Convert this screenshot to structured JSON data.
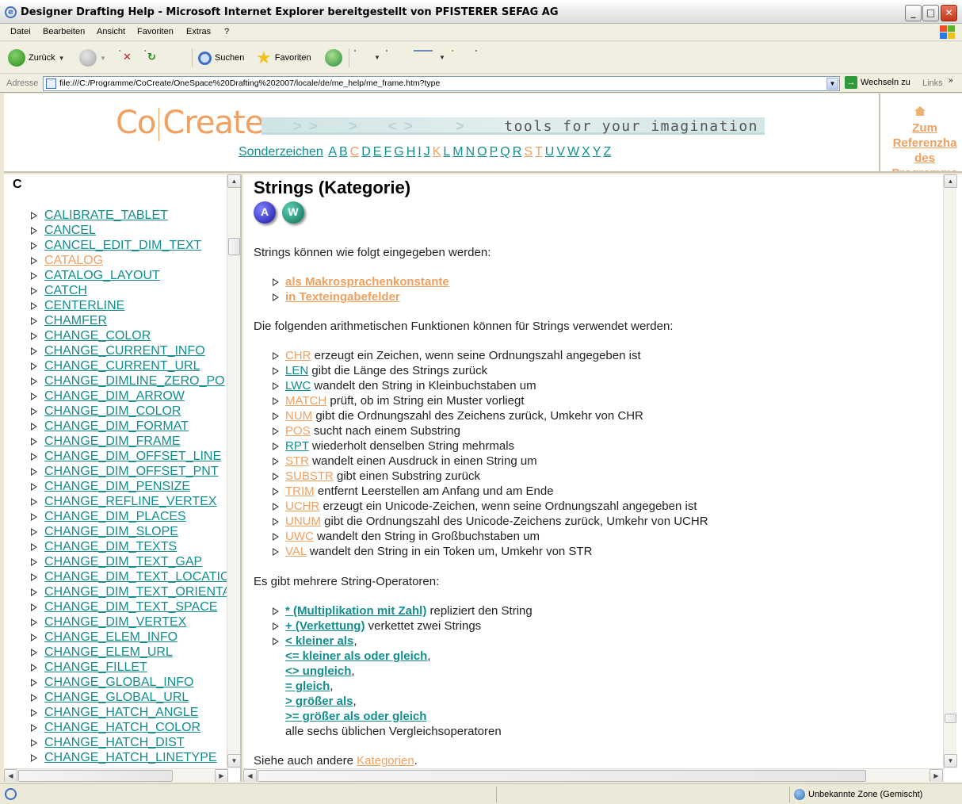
{
  "window": {
    "title": "Designer Drafting Help - Microsoft Internet Explorer bereitgestellt von PFISTERER SEFAG AG"
  },
  "menu": [
    "Datei",
    "Bearbeiten",
    "Ansicht",
    "Favoriten",
    "Extras",
    "?"
  ],
  "toolbar": {
    "back_label": "Zurück",
    "search_label": "Suchen",
    "favorites_label": "Favoriten"
  },
  "address": {
    "label": "Adresse",
    "url": "file:///C:/Programme/CoCreate/OneSpace%20Drafting%202007/locale/de/me_help/me_frame.htm?type",
    "go_label": "Wechseln zu",
    "links_label": "Links"
  },
  "header": {
    "logo_left": "Co",
    "logo_right": "Create",
    "tagline": "tools for your imagination",
    "special_chars": "Sonderzeichen",
    "letters": [
      {
        "l": "A",
        "c": "teal"
      },
      {
        "l": "B",
        "c": "teal"
      },
      {
        "l": "C",
        "c": "orange"
      },
      {
        "l": "D",
        "c": "teal"
      },
      {
        "l": "E",
        "c": "teal"
      },
      {
        "l": "F",
        "c": "teal"
      },
      {
        "l": "G",
        "c": "teal"
      },
      {
        "l": "H",
        "c": "teal"
      },
      {
        "l": "I",
        "c": "teal"
      },
      {
        "l": "J",
        "c": "teal"
      },
      {
        "l": "K",
        "c": "orange"
      },
      {
        "l": "L",
        "c": "teal"
      },
      {
        "l": "M",
        "c": "teal"
      },
      {
        "l": "N",
        "c": "teal"
      },
      {
        "l": "O",
        "c": "teal"
      },
      {
        "l": "P",
        "c": "teal"
      },
      {
        "l": "Q",
        "c": "teal"
      },
      {
        "l": "R",
        "c": "teal"
      },
      {
        "l": "S",
        "c": "orange"
      },
      {
        "l": "T",
        "c": "orange"
      },
      {
        "l": "U",
        "c": "teal"
      },
      {
        "l": "V",
        "c": "teal"
      },
      {
        "l": "W",
        "c": "teal"
      },
      {
        "l": "X",
        "c": "teal"
      },
      {
        "l": "Y",
        "c": "teal"
      },
      {
        "l": "Z",
        "c": "teal"
      }
    ],
    "ref_link_lines": [
      "Zum",
      "Referenzha",
      "des",
      "Programms"
    ]
  },
  "left": {
    "letter": "C",
    "items": [
      {
        "t": "CALIBRATE_TABLET",
        "c": "teal"
      },
      {
        "t": "CANCEL",
        "c": "teal"
      },
      {
        "t": "CANCEL_EDIT_DIM_TEXT",
        "c": "teal"
      },
      {
        "t": "CATALOG",
        "c": "orange"
      },
      {
        "t": "CATALOG_LAYOUT",
        "c": "teal"
      },
      {
        "t": "CATCH",
        "c": "teal"
      },
      {
        "t": "CENTERLINE",
        "c": "teal"
      },
      {
        "t": "CHAMFER",
        "c": "teal"
      },
      {
        "t": "CHANGE_COLOR",
        "c": "teal"
      },
      {
        "t": "CHANGE_CURRENT_INFO",
        "c": "teal"
      },
      {
        "t": "CHANGE_CURRENT_URL",
        "c": "teal"
      },
      {
        "t": "CHANGE_DIMLINE_ZERO_PO",
        "c": "teal"
      },
      {
        "t": "CHANGE_DIM_ARROW",
        "c": "teal"
      },
      {
        "t": "CHANGE_DIM_COLOR",
        "c": "teal"
      },
      {
        "t": "CHANGE_DIM_FORMAT",
        "c": "teal"
      },
      {
        "t": "CHANGE_DIM_FRAME",
        "c": "teal"
      },
      {
        "t": "CHANGE_DIM_OFFSET_LINE",
        "c": "teal"
      },
      {
        "t": "CHANGE_DIM_OFFSET_PNT",
        "c": "teal"
      },
      {
        "t": "CHANGE_DIM_PENSIZE",
        "c": "teal"
      },
      {
        "t": "CHANGE_REFLINE_VERTEX",
        "c": "teal"
      },
      {
        "t": "CHANGE_DIM_PLACES",
        "c": "teal"
      },
      {
        "t": "CHANGE_DIM_SLOPE",
        "c": "teal"
      },
      {
        "t": "CHANGE_DIM_TEXTS",
        "c": "teal"
      },
      {
        "t": "CHANGE_DIM_TEXT_GAP",
        "c": "teal"
      },
      {
        "t": "CHANGE_DIM_TEXT_LOCATIO",
        "c": "teal"
      },
      {
        "t": "CHANGE_DIM_TEXT_ORIENTA",
        "c": "teal"
      },
      {
        "t": "CHANGE_DIM_TEXT_SPACE",
        "c": "teal"
      },
      {
        "t": "CHANGE_DIM_VERTEX",
        "c": "teal"
      },
      {
        "t": "CHANGE_ELEM_INFO",
        "c": "teal"
      },
      {
        "t": "CHANGE_ELEM_URL",
        "c": "teal"
      },
      {
        "t": "CHANGE_FILLET",
        "c": "teal"
      },
      {
        "t": "CHANGE_GLOBAL_INFO",
        "c": "teal"
      },
      {
        "t": "CHANGE_GLOBAL_URL",
        "c": "teal"
      },
      {
        "t": "CHANGE_HATCH_ANGLE",
        "c": "teal"
      },
      {
        "t": "CHANGE_HATCH_COLOR",
        "c": "teal"
      },
      {
        "t": "CHANGE_HATCH_DIST",
        "c": "teal"
      },
      {
        "t": "CHANGE_HATCH_LINETYPE",
        "c": "teal"
      }
    ]
  },
  "main": {
    "title": "Strings (Kategorie)",
    "badge_a": "A",
    "badge_w": "W",
    "intro": "Strings können wie folgt eingegeben werden:",
    "input_links": [
      {
        "t": "als Makrosprachenkonstante",
        "c": "orange"
      },
      {
        "t": "in Texteingabefelder",
        "c": "orange"
      }
    ],
    "arith_intro": "Die folgenden arithmetischen Funktionen können für Strings verwendet werden:",
    "functions": [
      {
        "name": "CHR",
        "c": "orange",
        "desc": " erzeugt ein Zeichen, wenn seine Ordnungszahl angegeben ist"
      },
      {
        "name": "LEN",
        "c": "teal",
        "desc": " gibt die Länge des Strings zurück"
      },
      {
        "name": "LWC",
        "c": "teal",
        "desc": " wandelt den String in Kleinbuchstaben um"
      },
      {
        "name": "MATCH",
        "c": "orange",
        "desc": " prüft, ob im String ein Muster vorliegt"
      },
      {
        "name": "NUM",
        "c": "orange",
        "desc": " gibt die Ordnungszahl des Zeichens zurück, Umkehr von CHR"
      },
      {
        "name": "POS",
        "c": "orange",
        "desc": " sucht nach einem Substring"
      },
      {
        "name": "RPT",
        "c": "teal",
        "desc": " wiederholt denselben String mehrmals"
      },
      {
        "name": "STR",
        "c": "orange",
        "desc": " wandelt einen Ausdruck in einen String um"
      },
      {
        "name": "SUBSTR",
        "c": "orange",
        "desc": " gibt einen Substring zurück"
      },
      {
        "name": "TRIM",
        "c": "orange",
        "desc": " entfernt Leerstellen am Anfang und am Ende"
      },
      {
        "name": "UCHR",
        "c": "orange",
        "desc": " erzeugt ein Unicode-Zeichen, wenn seine Ordnungszahl angegeben ist"
      },
      {
        "name": "UNUM",
        "c": "orange",
        "desc": " gibt die Ordnungszahl des Unicode-Zeichens zurück, Umkehr von UCHR"
      },
      {
        "name": "UWC",
        "c": "orange",
        "desc": " wandelt den String in Großbuchstaben um"
      },
      {
        "name": "VAL",
        "c": "orange",
        "desc": " wandelt den String in ein Token um, Umkehr von STR"
      }
    ],
    "ops_intro": "Es gibt mehrere String-Operatoren:",
    "operators": [
      {
        "name": "* (Multiplikation mit Zahl)",
        "c": "teal",
        "desc": " repliziert den String",
        "tri": true
      },
      {
        "name": "+ (Verkettung)",
        "c": "teal",
        "desc": " verkettet zwei Strings",
        "tri": true
      },
      {
        "name": "< kleiner als",
        "c": "teal",
        "desc": ",",
        "tri": true
      },
      {
        "name": "<= kleiner als oder gleich",
        "c": "teal",
        "desc": ",",
        "tri": false
      },
      {
        "name": "<> ungleich",
        "c": "teal",
        "desc": ",",
        "tri": false
      },
      {
        "name": "= gleich",
        "c": "teal",
        "desc": ",",
        "tri": false
      },
      {
        "name": "> größer als",
        "c": "teal",
        "desc": ",",
        "tri": false
      },
      {
        "name": ">= größer als oder gleich",
        "c": "teal",
        "desc": "",
        "tri": false
      }
    ],
    "compare_note": "alle sechs üblichen Vergleichsoperatoren",
    "see_also_prefix": "Siehe auch andere ",
    "see_also_link": "Kategorien",
    "see_also_suffix": "."
  },
  "status": {
    "zone": "Unbekannte Zone (Gemischt)"
  },
  "colors": {
    "teal": "#128e8e",
    "orange": "#f0a060"
  }
}
